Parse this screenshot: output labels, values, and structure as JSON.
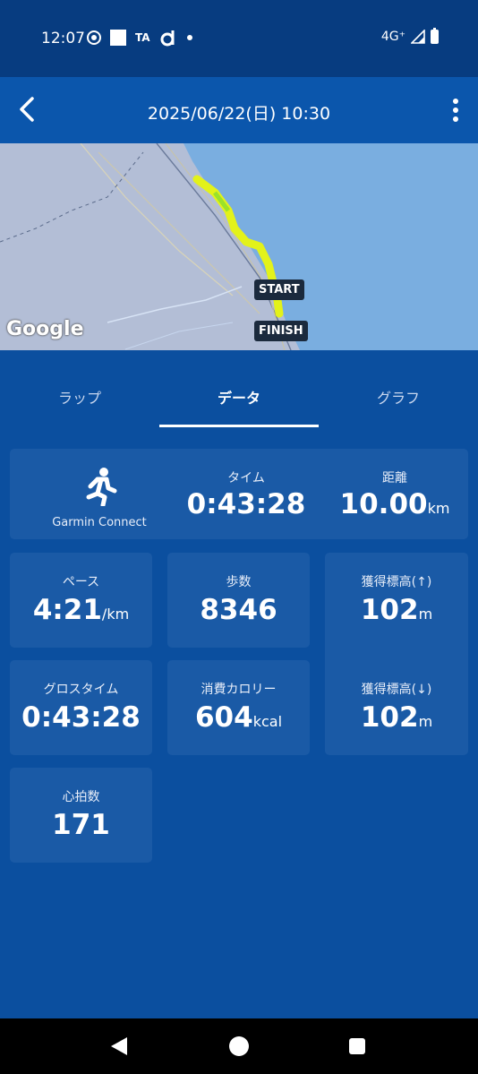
{
  "status_bar": {
    "time": "12:07",
    "icons_left": [
      "chrome-icon",
      "square-icon",
      "ta-icon",
      "d-icon",
      "dot-icon"
    ],
    "ta_text": "TA",
    "network": "4G⁺"
  },
  "header": {
    "title": "2025/06/22(日) 10:30"
  },
  "map": {
    "logo": "Google",
    "start_label": "START",
    "finish_label": "FINISH"
  },
  "tabs": [
    {
      "label": "ラップ",
      "active": false
    },
    {
      "label": "データ",
      "active": true
    },
    {
      "label": "グラフ",
      "active": false
    }
  ],
  "summary": {
    "source_label": "Garmin Connect",
    "time_label": "タイム",
    "time_value": "0:43:28",
    "distance_label": "距離",
    "distance_value": "10.00",
    "distance_unit": "km"
  },
  "stats": {
    "pace_label": "ペース",
    "pace_value": "4:21",
    "pace_unit": "/km",
    "steps_label": "歩数",
    "steps_value": "8346",
    "ascent_label": "獲得標高(↑)",
    "ascent_value": "102",
    "ascent_unit": "m",
    "gross_time_label": "グロスタイム",
    "gross_time_value": "0:43:28",
    "calories_label": "消費カロリー",
    "calories_value": "604",
    "calories_unit": "kcal",
    "descent_label": "獲得標高(↓)",
    "descent_value": "102",
    "descent_unit": "m",
    "heart_rate_label": "心拍数",
    "heart_rate_value": "171"
  },
  "colors": {
    "status_bar": "#073c80",
    "app_bar": "#0b56ac",
    "background": "#0b4f9f",
    "card": "#1a5aa6",
    "route": "#e3f21a",
    "water": "#7aaee0",
    "land": "#b3bed6"
  }
}
